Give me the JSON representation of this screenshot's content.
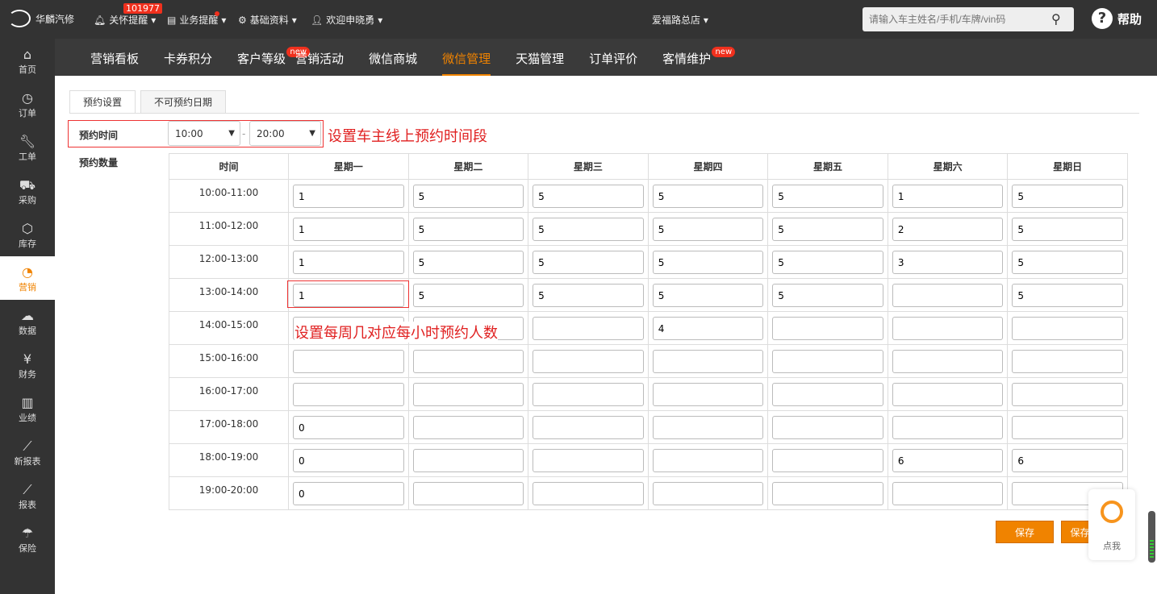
{
  "top": {
    "brand": "华麟汽修",
    "menus": [
      {
        "label": "关怀提醒",
        "icon": "bell-icon"
      },
      {
        "label": "业务提醒",
        "icon": "document-icon"
      },
      {
        "label": "基础资料",
        "icon": "gear-icon"
      },
      {
        "label": "欢迎申晓勇",
        "icon": "user-icon"
      }
    ],
    "badge": "101977",
    "store": "爱福路总店",
    "search_placeholder": "请输入车主姓名/手机/车牌/vin码",
    "help": "帮助"
  },
  "sidebar": [
    {
      "label": "首页",
      "icon": "home-icon"
    },
    {
      "label": "订单",
      "icon": "history-icon"
    },
    {
      "label": "工单",
      "icon": "wrench-icon"
    },
    {
      "label": "采购",
      "icon": "cart-icon"
    },
    {
      "label": "库存",
      "icon": "box-icon"
    },
    {
      "label": "营销",
      "icon": "pie-icon",
      "active": true
    },
    {
      "label": "数据",
      "icon": "cloud-icon"
    },
    {
      "label": "财务",
      "icon": "yen-icon"
    },
    {
      "label": "业绩",
      "icon": "bar-chart-icon"
    },
    {
      "label": "新报表",
      "icon": "line-chart-icon"
    },
    {
      "label": "报表",
      "icon": "line-chart-icon"
    },
    {
      "label": "保险",
      "icon": "umbrella-icon"
    }
  ],
  "nav": [
    {
      "label": "营销看板"
    },
    {
      "label": "卡券积分"
    },
    {
      "label": "客户等级",
      "new": "new"
    },
    {
      "label": "营销活动"
    },
    {
      "label": "微信商城"
    },
    {
      "label": "微信管理",
      "active": true
    },
    {
      "label": "天猫管理"
    },
    {
      "label": "订单评价"
    },
    {
      "label": "客情维护",
      "new": "new"
    }
  ],
  "accent": "#f08300",
  "tabs": [
    "预约设置",
    "不可预约日期"
  ],
  "form": {
    "time_label": "预约时间",
    "start": "10:00",
    "sep": "-",
    "end": "20:00",
    "count_label": "预约数量"
  },
  "notes": {
    "time": "设置车主线上预约时间段",
    "count": "设置每周几对应每小时预约人数"
  },
  "table": {
    "headers": [
      "时间",
      "星期一",
      "星期二",
      "星期三",
      "星期四",
      "星期五",
      "星期六",
      "星期日"
    ],
    "rows": [
      {
        "time": "10:00-11:00",
        "values": [
          "1",
          "5",
          "5",
          "5",
          "5",
          "1",
          "5"
        ]
      },
      {
        "time": "11:00-12:00",
        "values": [
          "1",
          "5",
          "5",
          "5",
          "5",
          "2",
          "5"
        ]
      },
      {
        "time": "12:00-13:00",
        "values": [
          "1",
          "5",
          "5",
          "5",
          "5",
          "3",
          "5"
        ]
      },
      {
        "time": "13:00-14:00",
        "values": [
          "1",
          "5",
          "5",
          "5",
          "5",
          "",
          "5"
        ]
      },
      {
        "time": "14:00-15:00",
        "values": [
          "",
          "",
          "",
          "4",
          "",
          "",
          ""
        ]
      },
      {
        "time": "15:00-16:00",
        "values": [
          "",
          "",
          "",
          "",
          "",
          "",
          ""
        ]
      },
      {
        "time": "16:00-17:00",
        "values": [
          "",
          "",
          "",
          "",
          "",
          "",
          ""
        ]
      },
      {
        "time": "17:00-18:00",
        "values": [
          "0",
          "",
          "",
          "",
          "",
          "",
          ""
        ]
      },
      {
        "time": "18:00-19:00",
        "values": [
          "0",
          "",
          "",
          "",
          "",
          "6",
          "6"
        ]
      },
      {
        "time": "19:00-20:00",
        "values": [
          "0",
          "",
          "",
          "",
          "",
          "",
          ""
        ]
      }
    ]
  },
  "buttons": {
    "save": "保存",
    "save_copy": "保存并复制"
  },
  "chat": {
    "label": "点我"
  }
}
